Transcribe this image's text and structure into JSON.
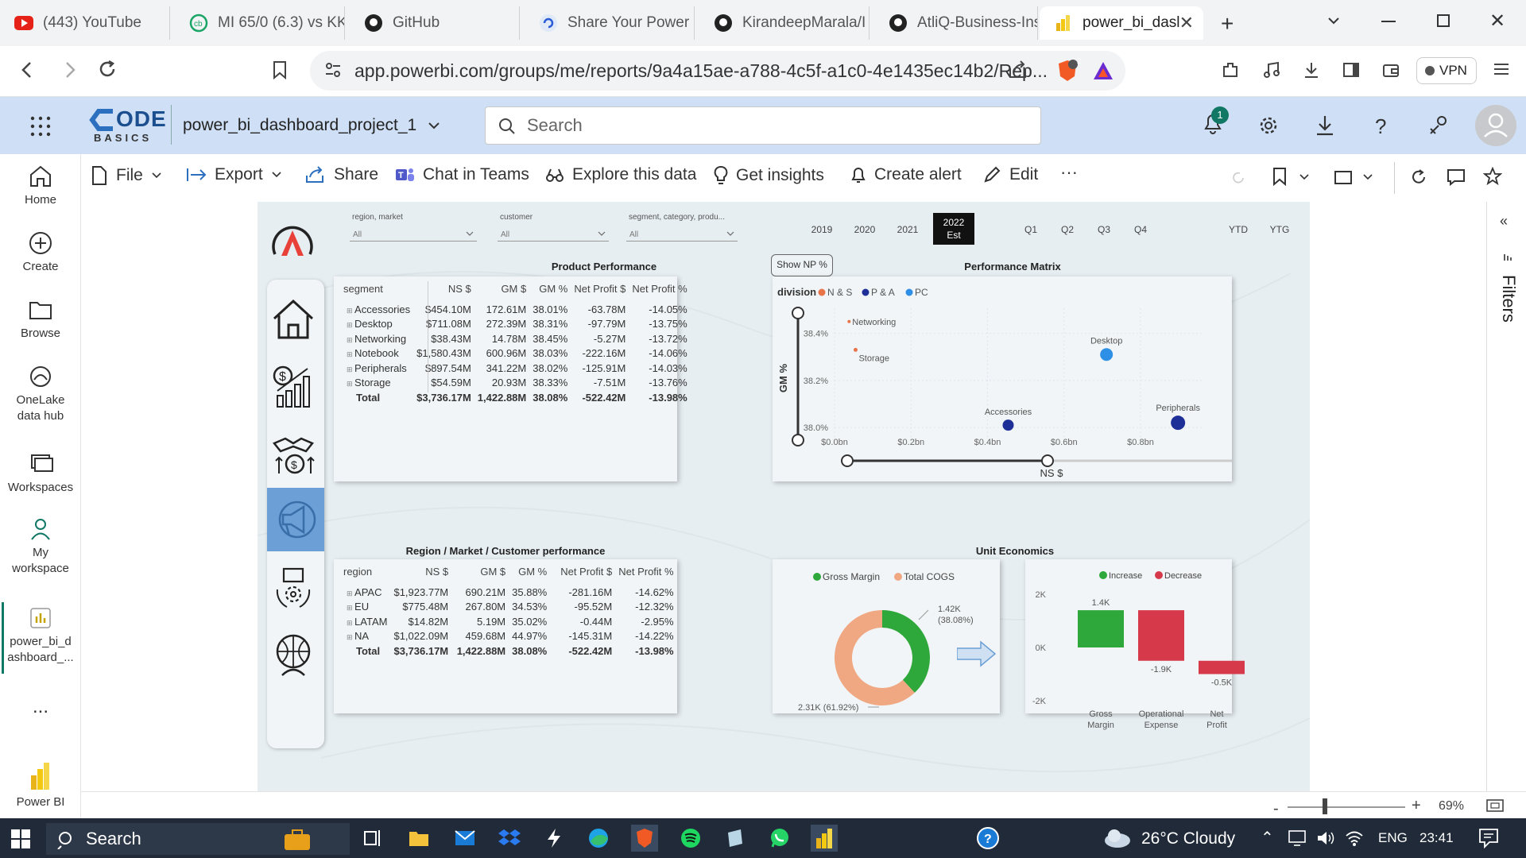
{
  "browser": {
    "tabs": [
      {
        "label": "(443) YouTube",
        "icon": "youtube-icon"
      },
      {
        "label": "MI 65/0 (6.3) vs KK",
        "icon": "cricbuzz-icon"
      },
      {
        "label": "GitHub",
        "icon": "github-icon"
      },
      {
        "label": "Share Your Power",
        "icon": "powerbi-community-icon"
      },
      {
        "label": "KirandeepMarala/I",
        "icon": "github-icon"
      },
      {
        "label": "AtliQ-Business-Ins",
        "icon": "github-icon"
      },
      {
        "label": "power_bi_dasl",
        "icon": "powerbi-icon"
      }
    ],
    "url": "app.powerbi.com/groups/me/reports/9a4a15ae-a788-4c5f-a1c0-4e1435ec14b2/Rep...",
    "brave_badge": "2",
    "vpn_label": "VPN"
  },
  "pbi_header": {
    "logo_text": "ODE",
    "logo_sub": "BASICS",
    "report_name": "power_bi_dashboard_project_1",
    "search_placeholder": "Search",
    "notification_count": "1"
  },
  "sidebar": {
    "items": [
      {
        "label": "Home",
        "icon": "home-icon"
      },
      {
        "label": "Create",
        "icon": "plus-circle-icon"
      },
      {
        "label": "Browse",
        "icon": "folder-icon"
      },
      {
        "label": "OneLake data hub",
        "icon": "onelake-icon"
      },
      {
        "label": "Workspaces",
        "icon": "workspaces-icon"
      },
      {
        "label": "My workspace",
        "icon": "person-icon"
      },
      {
        "label": "power_bi_d ashboard_...",
        "icon": "report-icon"
      }
    ],
    "more": "...",
    "product": "Power BI"
  },
  "commandbar": {
    "file": "File",
    "export": "Export",
    "share": "Share",
    "teams": "Chat in Teams",
    "explore": "Explore this data",
    "insights": "Get insights",
    "alert": "Create alert",
    "edit": "Edit",
    "more": "···"
  },
  "filters_label": "Filters",
  "report": {
    "slicers": [
      {
        "label": "region, market",
        "value": "All"
      },
      {
        "label": "customer",
        "value": "All"
      },
      {
        "label": "segment, category, produ...",
        "value": "All"
      }
    ],
    "years": [
      "2019",
      "2020",
      "2021"
    ],
    "selected_year": "2022",
    "selected_year_sub": "Est",
    "quarters": [
      "Q1",
      "Q2",
      "Q3",
      "Q4"
    ],
    "periods": [
      "YTD",
      "YTG"
    ],
    "show_np_button": "Show NP %",
    "product_performance": {
      "title": "Product Performance",
      "columns": [
        "segment",
        "NS $",
        "GM $",
        "GM %",
        "Net Profit $",
        "Net Profit %"
      ],
      "rows": [
        [
          "Accessories",
          "$454.10M",
          "172.61M",
          "38.01%",
          "-63.78M",
          "-14.05%"
        ],
        [
          "Desktop",
          "$711.08M",
          "272.39M",
          "38.31%",
          "-97.79M",
          "-13.75%"
        ],
        [
          "Networking",
          "$38.43M",
          "14.78M",
          "38.45%",
          "-5.27M",
          "-13.72%"
        ],
        [
          "Notebook",
          "$1,580.43M",
          "600.96M",
          "38.03%",
          "-222.16M",
          "-14.06%"
        ],
        [
          "Peripherals",
          "$897.54M",
          "341.22M",
          "38.02%",
          "-125.91M",
          "-14.03%"
        ],
        [
          "Storage",
          "$54.59M",
          "20.93M",
          "38.33%",
          "-7.51M",
          "-13.76%"
        ]
      ],
      "total": [
        "Total",
        "$3,736.17M",
        "1,422.88M",
        "38.08%",
        "-522.42M",
        "-13.98%"
      ]
    },
    "region_performance": {
      "title": "Region / Market / Customer performance",
      "columns": [
        "region",
        "NS $",
        "GM $",
        "GM %",
        "Net Profit $",
        "Net Profit %"
      ],
      "rows": [
        [
          "APAC",
          "$1,923.77M",
          "690.21M",
          "35.88%",
          "-281.16M",
          "-14.62%"
        ],
        [
          "EU",
          "$775.48M",
          "267.80M",
          "34.53%",
          "-95.52M",
          "-12.32%"
        ],
        [
          "LATAM",
          "$14.82M",
          "5.19M",
          "35.02%",
          "-0.44M",
          "-2.95%"
        ],
        [
          "NA",
          "$1,022.09M",
          "459.68M",
          "44.97%",
          "-145.31M",
          "-14.22%"
        ]
      ],
      "total": [
        "Total",
        "$3,736.17M",
        "1,422.88M",
        "38.08%",
        "-522.42M",
        "-13.98%"
      ]
    },
    "unit_economics": {
      "title": "Unit Economics"
    }
  },
  "chart_data": [
    {
      "type": "scatter",
      "title": "Performance Matrix",
      "xlabel": "NS $",
      "ylabel": "GM %",
      "legend_title": "division",
      "legend": [
        {
          "name": "N & S",
          "color": "#e8744a"
        },
        {
          "name": "P & A",
          "color": "#1f2f98"
        },
        {
          "name": "PC",
          "color": "#2e8fe6"
        }
      ],
      "x_ticks": [
        "$0.0bn",
        "$0.2bn",
        "$0.4bn",
        "$0.6bn",
        "$0.8bn"
      ],
      "y_ticks": [
        "38.4%",
        "38.2%",
        "38.0%"
      ],
      "xlim": [
        0,
        0.96
      ],
      "ylim": [
        37.98,
        38.5
      ],
      "points": [
        {
          "label": "Networking",
          "x": 0.038,
          "y": 38.45,
          "division": "N & S",
          "color": "#e8744a",
          "r": 2
        },
        {
          "label": "Storage",
          "x": 0.055,
          "y": 38.33,
          "division": "N & S",
          "color": "#e8744a",
          "r": 2.5
        },
        {
          "label": "Desktop",
          "x": 0.711,
          "y": 38.31,
          "division": "PC",
          "color": "#2e8fe6",
          "r": 8
        },
        {
          "label": "Accessories",
          "x": 0.454,
          "y": 38.01,
          "division": "P & A",
          "color": "#1f2f98",
          "r": 7
        },
        {
          "label": "Peripherals",
          "x": 0.898,
          "y": 38.02,
          "division": "P & A",
          "color": "#1f2f98",
          "r": 9
        }
      ]
    },
    {
      "type": "pie",
      "legend": [
        {
          "name": "Gross Margin",
          "color": "#2ea83a"
        },
        {
          "name": "Total COGS",
          "color": "#f0a883"
        }
      ],
      "slices": [
        {
          "name": "Gross Margin",
          "value": 1.42,
          "percent": 38.08,
          "label": "1.42K (38.08%)",
          "color": "#2ea83a"
        },
        {
          "name": "Total COGS",
          "value": 2.31,
          "percent": 61.92,
          "label": "2.31K (61.92%)",
          "color": "#f0a883"
        }
      ]
    },
    {
      "type": "bar",
      "subtype": "waterfall",
      "legend": [
        {
          "name": "Increase",
          "color": "#2ea83a"
        },
        {
          "name": "Decrease",
          "color": "#d63a4a"
        }
      ],
      "categories": [
        "Gross Margin",
        "Operational Expense",
        "Net Profit"
      ],
      "values": [
        1.4,
        -1.9,
        -0.5
      ],
      "data_labels": [
        "1.4K",
        "-1.9K",
        "-0.5K"
      ],
      "y_ticks": [
        "2K",
        "0K",
        "-2K"
      ],
      "ylim": [
        -2,
        2
      ]
    }
  ],
  "statusbar": {
    "zoom": "69%"
  },
  "taskbar": {
    "search": "Search",
    "weather": "26°C Cloudy",
    "lang": "ENG",
    "time": "23:41"
  }
}
